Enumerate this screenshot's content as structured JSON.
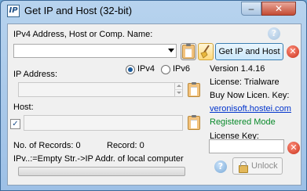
{
  "window": {
    "title": "Get IP and Host (32-bit)",
    "app_icon": "IP",
    "minimize": "–",
    "close": "✕"
  },
  "host_section": {
    "label": "IPv4 Address, Host or Comp. Name:",
    "combo_value": "",
    "get_button": "Get IP and Host"
  },
  "ip_version": {
    "ipv4": "IPv4",
    "ipv6": "IPv6",
    "selected": "IPv4"
  },
  "ip_section": {
    "label": "IP Address:",
    "value": ""
  },
  "host_field": {
    "label": "Host:",
    "value": "",
    "checked": true
  },
  "info": {
    "version": "Version 1.4.16",
    "license": "License: Trialware",
    "buy_now": "Buy Now Licen. Key:",
    "website": "veronisoft.hostei.com",
    "registered": "Registered Mode",
    "license_key_label": "License Key:",
    "license_key_value": ""
  },
  "records": {
    "num_label": "No. of Records: 0",
    "record_label": "Record: 0"
  },
  "hint": "IPv..:=Empty Str.->IP Addr. of local computer",
  "progress": 0,
  "unlock_button": "Unlock",
  "icons": {
    "help": "?",
    "clear": "✕"
  }
}
